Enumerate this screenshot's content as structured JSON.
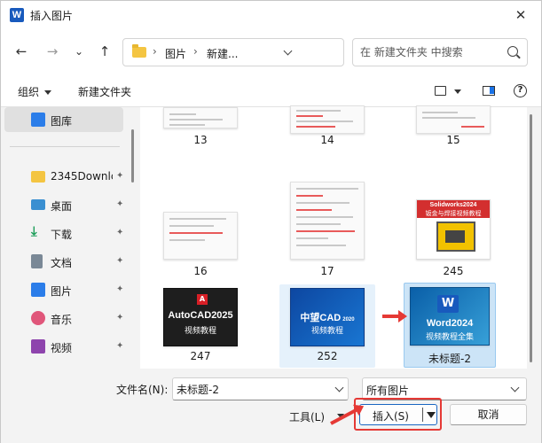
{
  "window": {
    "title": "插入图片",
    "app_icon_letter": "W",
    "close_glyph": "✕"
  },
  "nav": {
    "back_glyph": "←",
    "forward_glyph": "→",
    "recent_glyph": "⌄",
    "up_glyph": "↑",
    "sep_glyph": "›",
    "breadcrumbs": [
      "图片",
      "新建..."
    ],
    "search_placeholder": "在 新建文件夹 中搜索"
  },
  "toolbar": {
    "organize_label": "组织",
    "new_folder_label": "新建文件夹",
    "help_glyph": "?"
  },
  "sidebar": {
    "items": [
      {
        "label": "图库",
        "icon": "gallery-icon",
        "color": "#2b7de9"
      },
      {
        "label": "2345Downlc",
        "icon": "folder-icon",
        "color": "#f4c542"
      },
      {
        "label": "桌面",
        "icon": "desktop-icon",
        "color": "#3a8fd1"
      },
      {
        "label": "下载",
        "icon": "download-icon",
        "color": "#1e9e5a"
      },
      {
        "label": "文档",
        "icon": "document-icon",
        "color": "#7a8896"
      },
      {
        "label": "图片",
        "icon": "pictures-icon",
        "color": "#2b7de9"
      },
      {
        "label": "音乐",
        "icon": "music-icon",
        "color": "#e0567a"
      },
      {
        "label": "视频",
        "icon": "video-icon",
        "color": "#8e44ad"
      }
    ],
    "pin_glyph": "📌"
  },
  "files": [
    {
      "name": "13"
    },
    {
      "name": "14"
    },
    {
      "name": "15"
    },
    {
      "name": "16"
    },
    {
      "name": "17"
    },
    {
      "name": "245"
    },
    {
      "name": "247"
    },
    {
      "name": "252"
    },
    {
      "name": "未标题-2"
    }
  ],
  "thumbs": {
    "sw_title": "Solidworks2024",
    "sw_sub": "钣金与焊接视频教程",
    "autocad_badge": "A",
    "autocad_title": "AutoCAD2025",
    "autocad_sub": "视频教程",
    "zwcad_title": "中望CAD",
    "zwcad_year": "2020",
    "zwcad_sub": "视频教程",
    "word_badge": "W",
    "word_title": "Word2024",
    "word_sub": "视频教程全集"
  },
  "bottom": {
    "filename_label": "文件名(N):",
    "filename_value": "未标题-2",
    "filetype_value": "所有图片",
    "tools_label": "工具(L)",
    "insert_label": "插入(S)",
    "cancel_label": "取消"
  },
  "colors": {
    "accent": "#1a66c2",
    "annotation": "#e53935",
    "selection": "#cce4f7"
  }
}
